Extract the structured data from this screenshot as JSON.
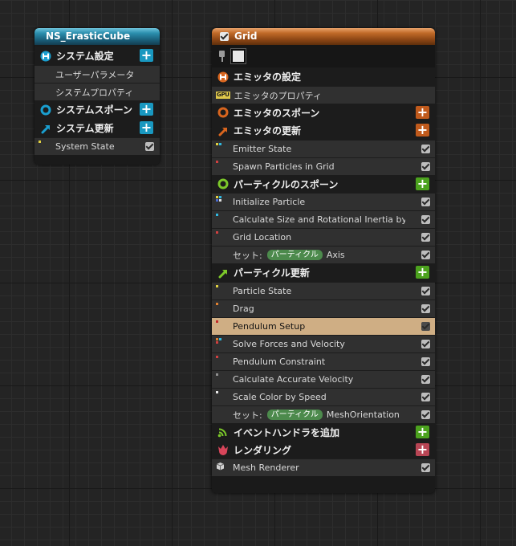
{
  "system_node": {
    "title": "NS_ErasticCube",
    "sections": {
      "settings": "システム設定",
      "user_params": "ユーザーパラメータ",
      "system_props": "システムプロパティ",
      "spawn": "システムスポーン",
      "update": "システム更新",
      "state": "System State"
    }
  },
  "emitter_node": {
    "title": "Grid",
    "sections": {
      "emitter_settings": "エミッタの設定",
      "gpu_badge": "GPU",
      "emitter_props": "エミッタのプロパティ",
      "emitter_spawn": "エミッタのスポーン",
      "emitter_update": "エミッタの更新",
      "particle_spawn": "パーティクルのスポーン",
      "particle_update": "パーティクル更新",
      "event_handler": "イベントハンドラを追加",
      "rendering": "レンダリング"
    },
    "emitter_update_items": [
      "Emitter State",
      "Spawn Particles in Grid"
    ],
    "particle_spawn_items": {
      "initialize": "Initialize Particle",
      "calc_size": "Calculate Size and Rotational Inertia by Mas",
      "grid_location": "Grid Location",
      "set_label": "セット:",
      "set_tag": "パーティクル",
      "set_attr": "Axis"
    },
    "particle_update_items": {
      "state": "Particle State",
      "drag": "Drag",
      "pendulum_setup": "Pendulum Setup",
      "solve_forces": "Solve Forces and Velocity",
      "pendulum_constraint": "Pendulum Constraint",
      "accurate_velocity": "Calculate Accurate Velocity",
      "scale_color": "Scale Color by Speed",
      "set_label": "セット:",
      "set_tag": "パーティクル",
      "set_attr": "MeshOrientation"
    },
    "renderer": "Mesh Renderer"
  },
  "plus_symbol": "+",
  "colors": {
    "system_accent": "#1998c0",
    "emitter_accent": "#c05a1c",
    "particle_accent": "#4ca21e",
    "render_accent": "#b84554",
    "selected_row": "#cfae84"
  }
}
